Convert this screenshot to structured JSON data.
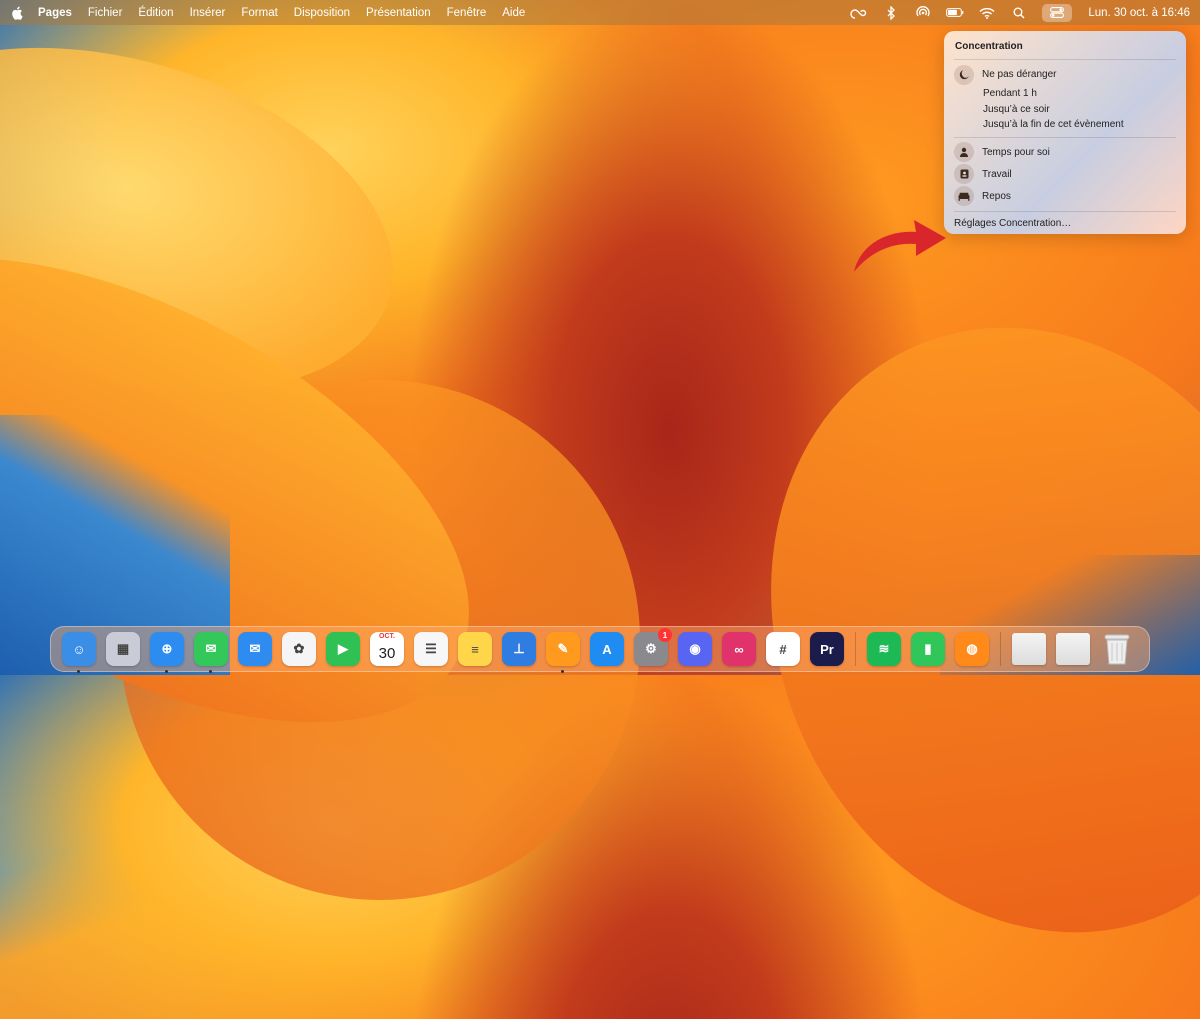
{
  "menubar": {
    "app_name": "Pages",
    "items": [
      "Fichier",
      "Édition",
      "Insérer",
      "Format",
      "Disposition",
      "Présentation",
      "Fenêtre",
      "Aide"
    ],
    "clock": "Lun. 30 oct. à 16:46",
    "status_icons": [
      "creative-cloud-icon",
      "bluetooth-icon",
      "airdrop-icon",
      "battery-icon",
      "wifi-icon",
      "search-icon",
      "control-center-icon"
    ]
  },
  "focus_panel": {
    "title": "Concentration",
    "dnd_label": "Ne pas déranger",
    "dnd_options": [
      "Pendant 1 h",
      "Jusqu’à ce soir",
      "Jusqu’à la fin de cet évènement"
    ],
    "modes": [
      "Temps pour soi",
      "Travail",
      "Repos"
    ],
    "settings_label": "Réglages Concentration…"
  },
  "dock": {
    "apps": [
      {
        "name": "Finder",
        "color": "#3a8ee6",
        "glyph": "☺",
        "running": true
      },
      {
        "name": "Launchpad",
        "color": "#c9ccd6",
        "glyph": "▦",
        "running": false
      },
      {
        "name": "Safari",
        "color": "#2c8cf0",
        "glyph": "⊕",
        "running": true
      },
      {
        "name": "Messages",
        "color": "#34c759",
        "glyph": "✉",
        "running": true
      },
      {
        "name": "Mail",
        "color": "#2e8bf0",
        "glyph": "✉",
        "running": false
      },
      {
        "name": "Photos",
        "color": "#f5f5f5",
        "glyph": "✿",
        "running": false
      },
      {
        "name": "FaceTime",
        "color": "#30c154",
        "glyph": "▶",
        "running": false
      },
      {
        "name": "Calendar",
        "color": "#ffffff",
        "glyph": "30",
        "running": false
      },
      {
        "name": "Reminders",
        "color": "#f7f7f7",
        "glyph": "☰",
        "running": false
      },
      {
        "name": "Notes",
        "color": "#ffd54a",
        "glyph": "≡",
        "running": false
      },
      {
        "name": "Keynote",
        "color": "#2f7de1",
        "glyph": "⊥",
        "running": false
      },
      {
        "name": "Pages",
        "color": "#ff9a1f",
        "glyph": "✎",
        "running": true
      },
      {
        "name": "App Store",
        "color": "#1f8cf2",
        "glyph": "A",
        "running": false
      },
      {
        "name": "System Settings",
        "color": "#8a8a8e",
        "glyph": "⚙",
        "running": false,
        "badge": "1"
      },
      {
        "name": "Discord",
        "color": "#5865f2",
        "glyph": "◉",
        "running": false
      },
      {
        "name": "Creative Cloud",
        "color": "#e0336b",
        "glyph": "∞",
        "running": false
      },
      {
        "name": "Slack",
        "color": "#ffffff",
        "glyph": "#",
        "running": false
      },
      {
        "name": "Premiere Pro",
        "color": "#1c1c4c",
        "glyph": "Pr",
        "running": false
      }
    ],
    "recent_apps": [
      {
        "name": "Spotify",
        "color": "#1db954",
        "glyph": "≋"
      },
      {
        "name": "Numbers",
        "color": "#31c65a",
        "glyph": "▮"
      },
      {
        "name": "Firefox",
        "color": "#ff8a1a",
        "glyph": "◍"
      }
    ],
    "calendar_month": "OCT."
  },
  "colors": {
    "arrow": "#d8262b",
    "panel_text": "#222222"
  }
}
